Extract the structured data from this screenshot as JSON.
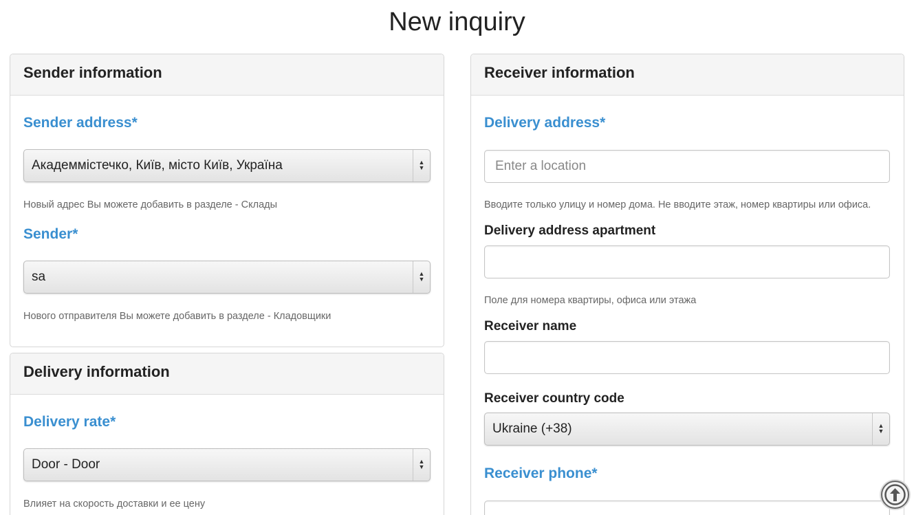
{
  "page": {
    "title": "New inquiry"
  },
  "sender_panel": {
    "title": "Sender information",
    "address_label": "Sender address",
    "address_value": "Академмістечко, Київ, місто Київ, Україна",
    "address_help": "Новый адрес Вы можете добавить в разделе - Склады",
    "sender_label": "Sender",
    "sender_value": "sa",
    "sender_help": "Нового отправителя Вы можете добавить в разделе - Кладовщики"
  },
  "delivery_panel": {
    "title": "Delivery information",
    "rate_label": "Delivery rate",
    "rate_value": "Door - Door",
    "rate_help": "Влияет на скорость доставки и ее цену"
  },
  "receiver_panel": {
    "title": "Receiver information",
    "address_label": "Delivery address",
    "address_placeholder": "Enter a location",
    "address_help": "Вводите только улицу и номер дома. Не вводите этаж, номер квартиры или офиса.",
    "apartment_label": "Delivery address apartment",
    "apartment_value": "",
    "apartment_help": "Поле для номера квартиры, офиса или этажа",
    "name_label": "Receiver name",
    "name_value": "",
    "country_label": "Receiver country code",
    "country_value": "Ukraine (+38)",
    "phone_label": "Receiver phone",
    "phone_value": ""
  },
  "required_mark": "*",
  "icons": {
    "select_arrows": "up-down-arrows-icon",
    "scroll_top": "arrow-up-circle-icon"
  }
}
